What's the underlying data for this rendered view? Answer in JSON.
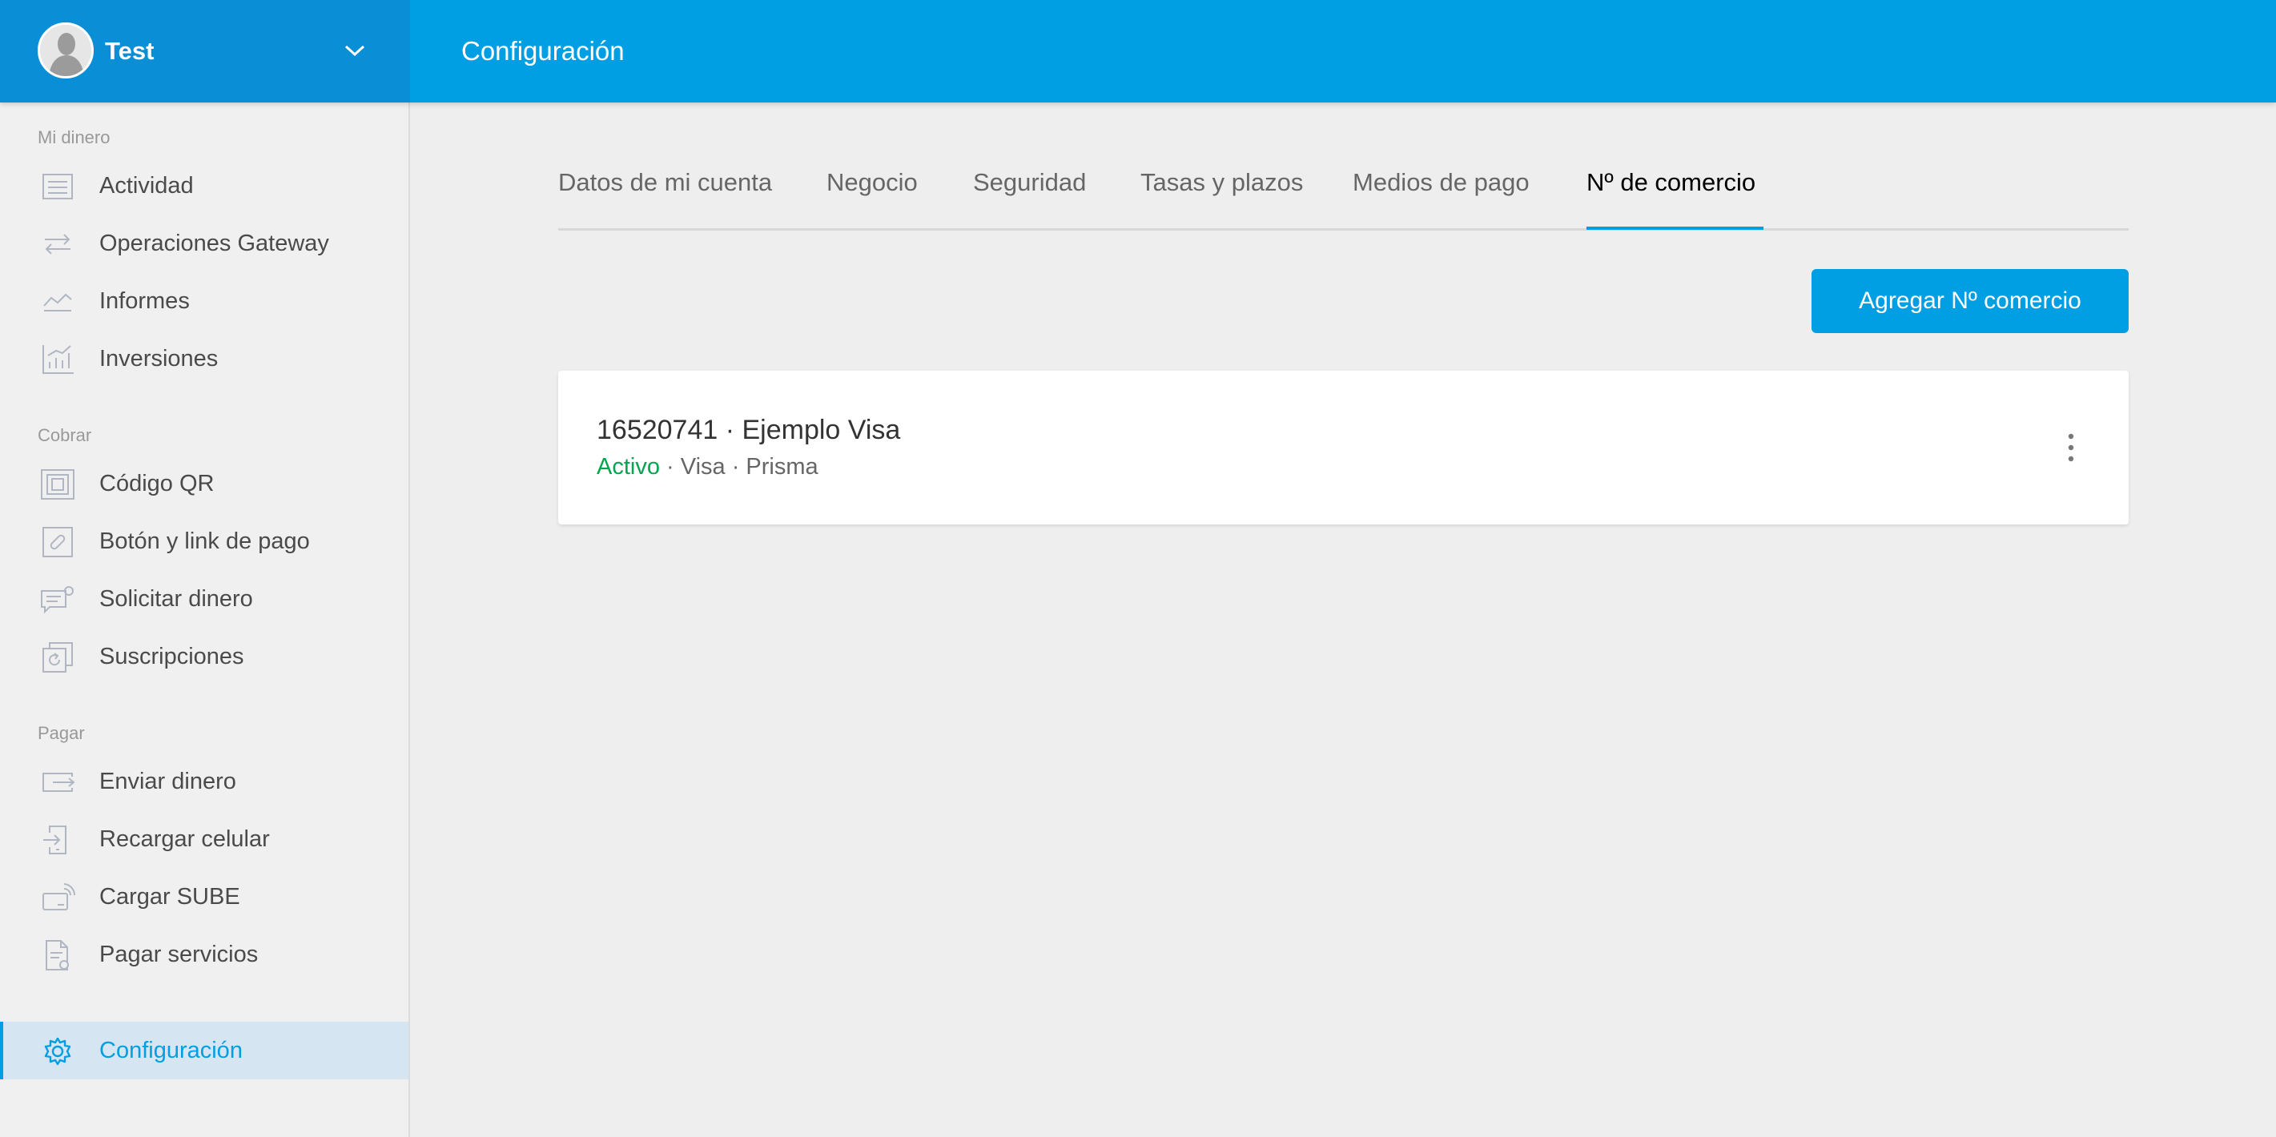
{
  "header": {
    "account_name": "Test",
    "page_title": "Configuración"
  },
  "sidebar": {
    "sections": [
      {
        "label": "Mi dinero",
        "items": [
          {
            "label": "Actividad",
            "icon": "list-icon"
          },
          {
            "label": "Operaciones Gateway",
            "icon": "transfer-arrows-icon"
          },
          {
            "label": "Informes",
            "icon": "trend-line-icon"
          },
          {
            "label": "Inversiones",
            "icon": "chart-growth-icon"
          }
        ]
      },
      {
        "label": "Cobrar",
        "items": [
          {
            "label": "Código QR",
            "icon": "qr-icon"
          },
          {
            "label": "Botón y link de pago",
            "icon": "link-icon"
          },
          {
            "label": "Solicitar dinero",
            "icon": "request-money-icon"
          },
          {
            "label": "Suscripciones",
            "icon": "subscription-icon"
          }
        ]
      },
      {
        "label": "Pagar",
        "items": [
          {
            "label": "Enviar dinero",
            "icon": "send-money-icon"
          },
          {
            "label": "Recargar celular",
            "icon": "phone-recharge-icon"
          },
          {
            "label": "Cargar SUBE",
            "icon": "sube-card-icon"
          },
          {
            "label": "Pagar servicios",
            "icon": "bill-icon"
          }
        ]
      }
    ],
    "settings_item": {
      "label": "Configuración",
      "icon": "gear-icon",
      "active": true
    }
  },
  "tabs": [
    {
      "label": "Datos de mi cuenta",
      "active": false
    },
    {
      "label": "Negocio",
      "active": false
    },
    {
      "label": "Seguridad",
      "active": false
    },
    {
      "label": "Tasas y plazos",
      "active": false
    },
    {
      "label": "Medios de pago",
      "active": false
    },
    {
      "label": "Nº de comercio",
      "active": true
    }
  ],
  "actions": {
    "add_label": "Agregar Nº comercio"
  },
  "merchants": [
    {
      "title": "16520741 · Ejemplo Visa",
      "status": "Activo",
      "details": " · Visa · Prisma"
    }
  ],
  "colors": {
    "brand_blue": "#009ee3",
    "account_blue": "#0a8fd6",
    "status_green": "#00a650",
    "active_item_bg": "#d5e5f2"
  }
}
